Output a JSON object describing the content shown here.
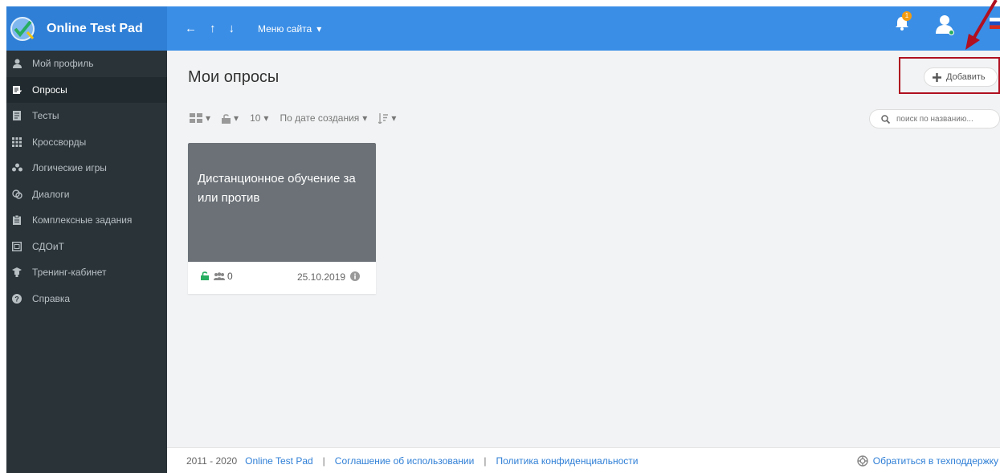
{
  "header": {
    "brand": "Online Test Pad",
    "nav_back": "←",
    "nav_up": "↑",
    "nav_down": "↓",
    "menu_label": "Меню сайта",
    "notification_count": "1"
  },
  "sidebar": {
    "items": [
      {
        "label": "Мой профиль",
        "icon": "user-icon"
      },
      {
        "label": "Опросы",
        "icon": "poll-icon"
      },
      {
        "label": "Тесты",
        "icon": "test-icon"
      },
      {
        "label": "Кроссворды",
        "icon": "grid-icon"
      },
      {
        "label": "Логические игры",
        "icon": "puzzle-icon"
      },
      {
        "label": "Диалоги",
        "icon": "dialog-icon"
      },
      {
        "label": "Комплексные задания",
        "icon": "clipboard-icon"
      },
      {
        "label": "СДОиТ",
        "icon": "calendar-icon"
      },
      {
        "label": "Тренинг-кабинет",
        "icon": "graduation-icon"
      },
      {
        "label": "Справка",
        "icon": "help-icon"
      }
    ],
    "active_index": 1
  },
  "main": {
    "title": "Мои опросы",
    "add_label": "Добавить",
    "page_size": "10",
    "sort_label": "По дате создания",
    "search_placeholder": "поиск по названию..."
  },
  "card": {
    "title": "Дистанционное обучение за или против",
    "participants": "0",
    "date": "25.10.2019"
  },
  "footer": {
    "years": "2011 - 2020",
    "brand_link": "Online Test Pad",
    "terms_link": "Соглашение об использовании",
    "privacy_link": "Политика конфиденциальности",
    "support_link": "Обратиться в техподдержку",
    "separator": "|"
  },
  "colors": {
    "topbar": "#3a8ee6",
    "sidebar": "#2a3338",
    "card": "#6b7177",
    "highlight": "#b01020"
  }
}
